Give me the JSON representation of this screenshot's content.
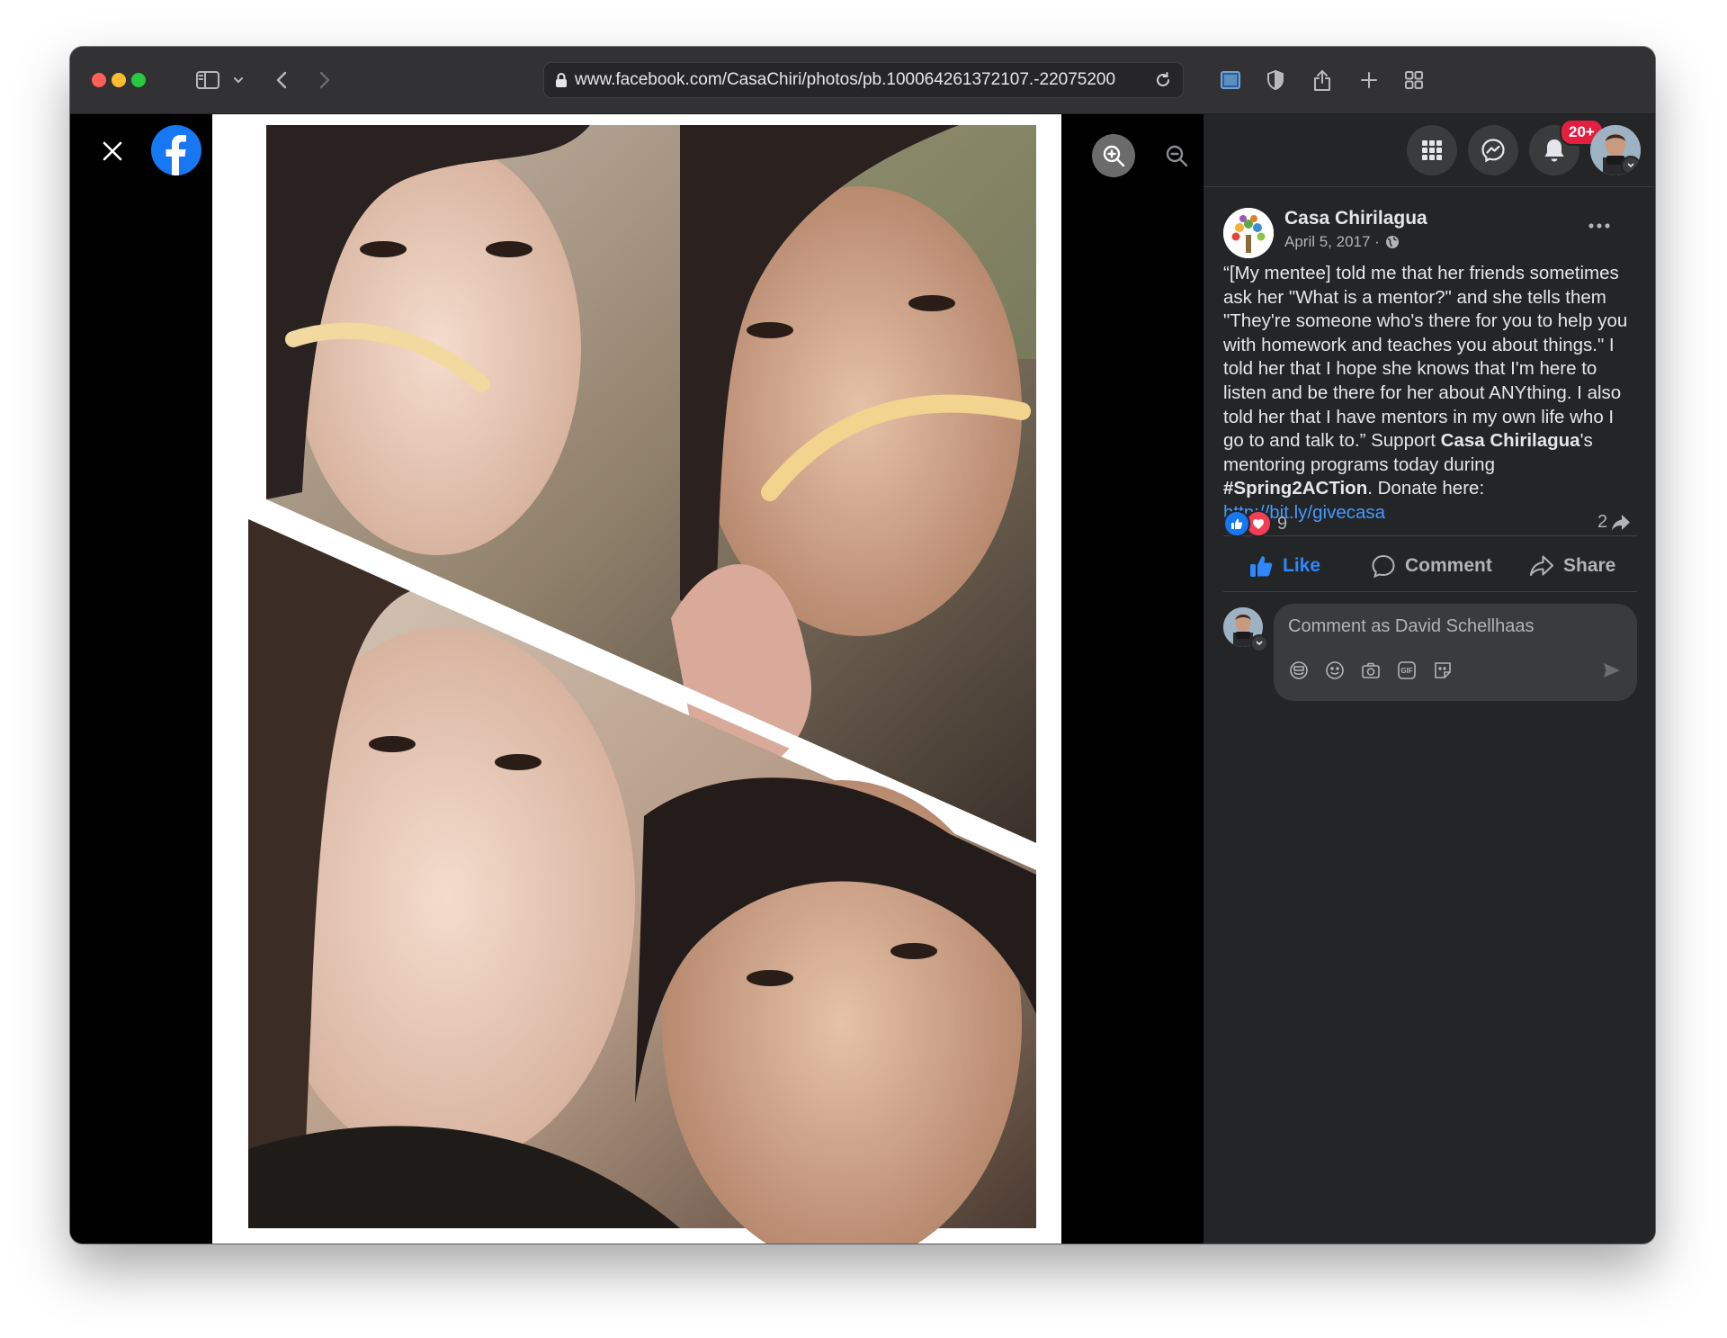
{
  "browser": {
    "url": "www.facebook.com/CasaChiri/photos/pb.100064261372107.-22075200"
  },
  "notifications": {
    "badge": "20+"
  },
  "post": {
    "page_name": "Casa Chirilagua",
    "date": "April 5, 2017 ·",
    "text_parts": {
      "p1": "“[My mentee] told me that her friends sometimes ask her \"What is a mentor?\" and she tells them \"They're someone who's there for you to help you with homework and teaches you about things.\" I told her that I hope she knows that I'm here to listen and be there for her about ANYthing. I also told her that I have mentors in my own life who I go to and talk to.” Support ",
      "b1": "Casa Chirilagua",
      "p2": "'s mentoring programs today during ",
      "b2": "#Spring2ACTion",
      "p3": ". Donate here: ",
      "link": "http://bit.ly/givecasa"
    },
    "reaction_count": "9",
    "share_count": "2",
    "actions": {
      "like": "Like",
      "comment": "Comment",
      "share": "Share"
    },
    "comment_placeholder": "Comment as David Schellhaas",
    "gif_label": "GIF"
  },
  "colors": {
    "facebook_blue": "#1877f2",
    "link_blue": "#4599ff",
    "badge_red": "#e41e3f",
    "panel_bg": "#242526"
  },
  "icons": {
    "close": "close-icon",
    "zoom_in": "zoom-in-icon",
    "zoom_out": "zoom-out-icon",
    "fullscreen": "fullscreen-icon",
    "menu": "grid-menu-icon",
    "messenger": "messenger-icon",
    "notifications": "bell-icon",
    "globe": "globe-icon"
  }
}
